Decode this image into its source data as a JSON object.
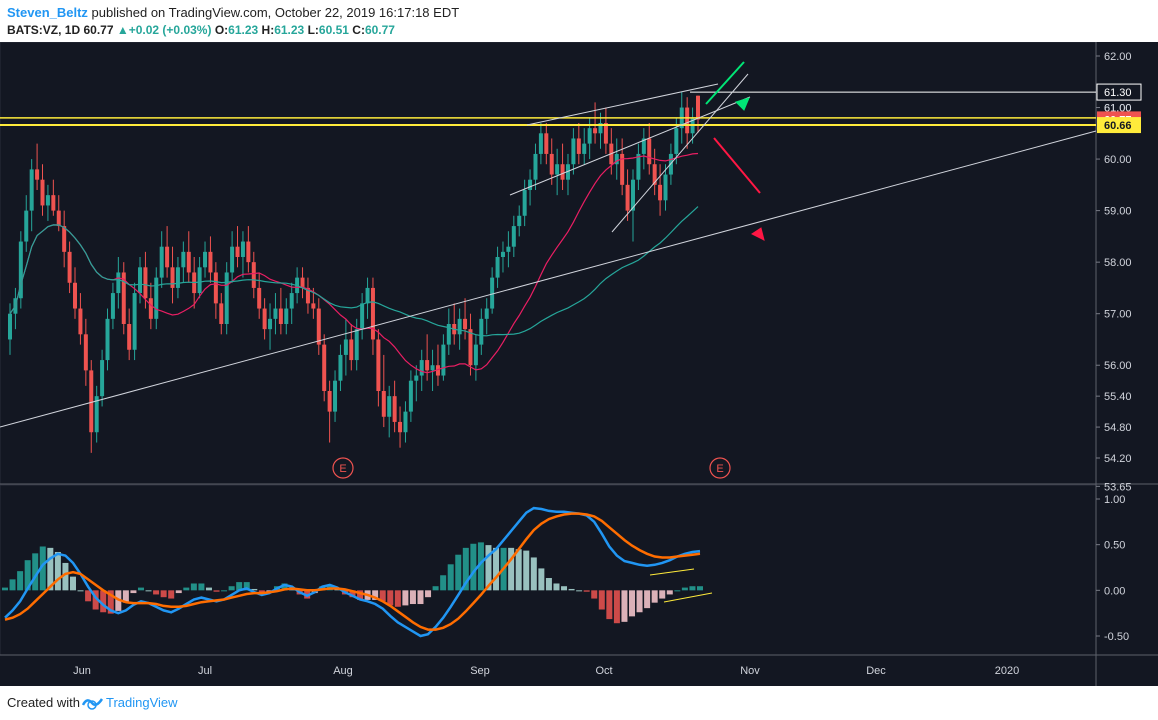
{
  "header": {
    "author": "Steven_Beltz",
    "published_text": "published on TradingView.com, October 22, 2019 16:17:18 EDT",
    "symbol": "BATS:VZ, 1D",
    "last": "60.77",
    "change_arrow": "▲",
    "change": "+0.02 (+0.03%)",
    "o_label": "O:",
    "o": "61.23",
    "h_label": "H:",
    "h": "61.23",
    "l_label": "L:",
    "l": "60.51",
    "c_label": "C:",
    "c": "60.77"
  },
  "footer": {
    "created_with": "Created with",
    "brand": "TradingView"
  },
  "colors": {
    "background": "#131722",
    "up": "#26a69a",
    "down": "#ef5350",
    "ma_fast": "#e91e63",
    "ma_slow": "#26a69a",
    "macd": "#2196f3",
    "signal": "#ff6d00",
    "hline": "#ffeb3b",
    "trend": "#d1d4dc"
  },
  "chart_data": [
    {
      "type": "candlestick",
      "symbol": "BATS:VZ",
      "timeframe": "1D",
      "y_axis_ticks": [
        "62.00",
        "61.00",
        "60.00",
        "59.00",
        "58.00",
        "57.00",
        "56.00",
        "55.40",
        "54.80",
        "54.20",
        "53.65"
      ],
      "y_axis_values": [
        62.0,
        61.0,
        60.0,
        59.0,
        58.0,
        57.0,
        56.0,
        55.4,
        54.8,
        54.2,
        53.65
      ],
      "x_axis_labels": [
        "Jun",
        "Jul",
        "Aug",
        "Sep",
        "Oct",
        "Nov",
        "Dec",
        "2020"
      ],
      "price_labels": [
        {
          "text": "61.30",
          "value": 61.3
        },
        {
          "text": "61.00",
          "value": 61.0
        },
        {
          "text": "60.77",
          "value": 60.77
        },
        {
          "text": "60.66",
          "value": 60.66
        }
      ],
      "horizontal_lines": [
        61.3,
        60.8,
        60.66
      ],
      "earnings_markers": [
        {
          "label": "E",
          "date": "2019-07-30"
        },
        {
          "label": "E",
          "date": "2019-10-22"
        }
      ],
      "candles_ohlc": [
        [
          56.5,
          57.2,
          56.2,
          57.0
        ],
        [
          57.0,
          57.5,
          56.7,
          57.3
        ],
        [
          57.3,
          58.6,
          57.1,
          58.4
        ],
        [
          58.4,
          59.3,
          58.2,
          59.0
        ],
        [
          59.0,
          60.0,
          58.6,
          59.8
        ],
        [
          59.8,
          60.3,
          59.4,
          59.6
        ],
        [
          59.6,
          59.9,
          58.9,
          59.1
        ],
        [
          59.1,
          59.5,
          58.8,
          59.3
        ],
        [
          59.3,
          59.6,
          58.9,
          59.0
        ],
        [
          59.0,
          59.3,
          58.6,
          58.7
        ],
        [
          58.7,
          59.0,
          57.9,
          58.2
        ],
        [
          58.2,
          58.4,
          57.4,
          57.6
        ],
        [
          57.6,
          57.9,
          56.9,
          57.1
        ],
        [
          57.1,
          57.4,
          56.4,
          56.6
        ],
        [
          56.6,
          56.9,
          55.6,
          55.9
        ],
        [
          55.9,
          56.1,
          54.3,
          54.7
        ],
        [
          54.7,
          55.6,
          54.5,
          55.4
        ],
        [
          55.4,
          56.3,
          55.2,
          56.1
        ],
        [
          56.1,
          57.1,
          55.9,
          56.9
        ],
        [
          56.9,
          57.6,
          56.7,
          57.4
        ],
        [
          57.4,
          58.1,
          57.1,
          57.8
        ],
        [
          57.8,
          58.0,
          56.6,
          56.8
        ],
        [
          56.8,
          57.1,
          56.1,
          56.3
        ],
        [
          56.3,
          57.6,
          56.1,
          57.4
        ],
        [
          57.4,
          58.1,
          57.2,
          57.9
        ],
        [
          57.9,
          58.2,
          57.1,
          57.3
        ],
        [
          57.3,
          57.6,
          56.7,
          56.9
        ],
        [
          56.9,
          57.9,
          56.7,
          57.7
        ],
        [
          57.7,
          58.6,
          57.5,
          58.3
        ],
        [
          58.3,
          58.7,
          57.7,
          57.9
        ],
        [
          57.9,
          58.3,
          57.2,
          57.5
        ],
        [
          57.5,
          58.1,
          57.3,
          57.9
        ],
        [
          57.9,
          58.4,
          57.6,
          58.2
        ],
        [
          58.2,
          58.6,
          57.6,
          57.8
        ],
        [
          57.8,
          58.1,
          57.1,
          57.4
        ],
        [
          57.4,
          58.1,
          57.3,
          57.9
        ],
        [
          57.9,
          58.4,
          57.7,
          58.2
        ],
        [
          58.2,
          58.5,
          57.6,
          57.8
        ],
        [
          57.8,
          58.0,
          56.9,
          57.2
        ],
        [
          57.2,
          57.4,
          56.6,
          56.8
        ],
        [
          56.8,
          58.0,
          56.6,
          57.8
        ],
        [
          57.8,
          58.6,
          57.6,
          58.3
        ],
        [
          58.3,
          58.7,
          57.9,
          58.1
        ],
        [
          58.1,
          58.6,
          57.7,
          58.4
        ],
        [
          58.4,
          58.7,
          57.8,
          58.0
        ],
        [
          58.0,
          58.2,
          57.3,
          57.5
        ],
        [
          57.5,
          57.8,
          56.9,
          57.1
        ],
        [
          57.1,
          57.3,
          56.5,
          56.7
        ],
        [
          56.7,
          57.2,
          56.3,
          56.9
        ],
        [
          56.9,
          57.4,
          56.6,
          57.1
        ],
        [
          57.1,
          57.5,
          56.6,
          56.8
        ],
        [
          56.8,
          57.3,
          56.6,
          57.1
        ],
        [
          57.1,
          57.6,
          56.8,
          57.4
        ],
        [
          57.4,
          57.9,
          57.2,
          57.7
        ],
        [
          57.7,
          57.9,
          57.3,
          57.5
        ],
        [
          57.5,
          57.7,
          57.0,
          57.2
        ],
        [
          57.2,
          57.5,
          56.9,
          57.1
        ],
        [
          57.1,
          57.3,
          56.2,
          56.4
        ],
        [
          56.4,
          56.6,
          55.3,
          55.5
        ],
        [
          55.5,
          55.7,
          54.5,
          55.1
        ],
        [
          55.1,
          55.9,
          54.9,
          55.7
        ],
        [
          55.7,
          56.4,
          55.5,
          56.2
        ],
        [
          56.2,
          56.9,
          55.8,
          56.5
        ],
        [
          56.5,
          56.8,
          55.9,
          56.1
        ],
        [
          56.1,
          56.9,
          55.9,
          56.7
        ],
        [
          56.7,
          57.4,
          56.5,
          57.2
        ],
        [
          57.2,
          57.7,
          56.9,
          57.5
        ],
        [
          57.5,
          57.7,
          56.2,
          56.5
        ],
        [
          56.5,
          56.7,
          55.2,
          55.5
        ],
        [
          55.5,
          56.2,
          54.8,
          55.0
        ],
        [
          55.0,
          55.6,
          54.6,
          55.4
        ],
        [
          55.4,
          55.7,
          54.7,
          54.9
        ],
        [
          54.9,
          55.2,
          54.4,
          54.7
        ],
        [
          54.7,
          55.3,
          54.5,
          55.1
        ],
        [
          55.1,
          55.9,
          54.9,
          55.7
        ],
        [
          55.7,
          56.0,
          55.3,
          55.8
        ],
        [
          55.8,
          56.3,
          55.5,
          56.1
        ],
        [
          56.1,
          56.6,
          55.7,
          55.9
        ],
        [
          55.9,
          56.3,
          55.5,
          56.0
        ],
        [
          56.0,
          56.4,
          55.6,
          55.8
        ],
        [
          55.8,
          56.6,
          55.7,
          56.4
        ],
        [
          56.4,
          57.1,
          56.2,
          56.8
        ],
        [
          56.8,
          57.2,
          56.4,
          56.6
        ],
        [
          56.6,
          57.1,
          56.3,
          56.9
        ],
        [
          56.9,
          57.3,
          56.5,
          56.7
        ],
        [
          56.7,
          57.0,
          55.8,
          56.0
        ],
        [
          56.0,
          56.6,
          55.7,
          56.4
        ],
        [
          56.4,
          57.1,
          56.2,
          56.9
        ],
        [
          56.9,
          57.3,
          56.6,
          57.1
        ],
        [
          57.1,
          57.9,
          57.0,
          57.7
        ],
        [
          57.7,
          58.3,
          57.5,
          58.1
        ],
        [
          58.1,
          58.4,
          57.8,
          58.2
        ],
        [
          58.2,
          58.6,
          57.9,
          58.3
        ],
        [
          58.3,
          58.9,
          58.1,
          58.7
        ],
        [
          58.7,
          59.1,
          58.5,
          58.9
        ],
        [
          58.9,
          59.6,
          58.7,
          59.4
        ],
        [
          59.4,
          59.8,
          59.1,
          59.6
        ],
        [
          59.6,
          60.3,
          59.4,
          60.1
        ],
        [
          60.1,
          60.7,
          59.9,
          60.5
        ],
        [
          60.5,
          60.7,
          59.9,
          60.1
        ],
        [
          60.1,
          60.4,
          59.5,
          59.7
        ],
        [
          59.7,
          60.2,
          59.3,
          59.9
        ],
        [
          59.9,
          60.3,
          59.4,
          59.6
        ],
        [
          59.6,
          60.1,
          59.3,
          59.9
        ],
        [
          59.9,
          60.6,
          59.7,
          60.4
        ],
        [
          60.4,
          60.7,
          59.9,
          60.1
        ],
        [
          60.1,
          60.6,
          59.9,
          60.3
        ],
        [
          60.3,
          60.8,
          60.0,
          60.6
        ],
        [
          60.6,
          61.1,
          60.3,
          60.5
        ],
        [
          60.5,
          60.9,
          60.2,
          60.7
        ],
        [
          60.7,
          61.0,
          60.1,
          60.3
        ],
        [
          60.3,
          60.6,
          59.7,
          59.9
        ],
        [
          59.9,
          60.4,
          59.6,
          60.1
        ],
        [
          60.1,
          60.4,
          59.3,
          59.5
        ],
        [
          59.5,
          59.8,
          58.8,
          59.0
        ],
        [
          59.0,
          59.8,
          58.4,
          59.6
        ],
        [
          59.6,
          60.3,
          59.4,
          60.1
        ],
        [
          60.1,
          60.6,
          59.8,
          60.4
        ],
        [
          60.4,
          60.7,
          59.7,
          59.9
        ],
        [
          59.9,
          60.2,
          59.3,
          59.5
        ],
        [
          59.5,
          59.9,
          58.9,
          59.2
        ],
        [
          59.2,
          59.9,
          59.0,
          59.7
        ],
        [
          59.7,
          60.3,
          59.5,
          60.1
        ],
        [
          60.1,
          60.8,
          59.9,
          60.6
        ],
        [
          60.6,
          61.3,
          60.3,
          61.0
        ],
        [
          61.0,
          61.2,
          60.2,
          60.5
        ],
        [
          60.5,
          61.0,
          60.3,
          60.8
        ],
        [
          61.23,
          61.23,
          60.51,
          60.77
        ]
      ],
      "moving_averages": {
        "fast_visible": true,
        "slow_visible": true
      }
    },
    {
      "type": "line",
      "name": "MACD",
      "y_axis_ticks": [
        "1.00",
        "0.50",
        "0.00",
        "-0.50"
      ],
      "y_axis_values": [
        1.0,
        0.5,
        0.0,
        -0.5
      ],
      "series": [
        {
          "values": [
            -0.3,
            -0.22,
            -0.12,
            0.02,
            0.15,
            0.28,
            0.35,
            0.4,
            0.38,
            0.3,
            0.18,
            0.04,
            -0.08,
            -0.16,
            -0.22,
            -0.25,
            -0.22,
            -0.16,
            -0.12,
            -0.14,
            -0.18,
            -0.22,
            -0.24,
            -0.2,
            -0.15,
            -0.1,
            -0.08,
            -0.1,
            -0.12,
            -0.1,
            -0.05,
            0.0,
            0.02,
            -0.02,
            -0.05,
            -0.03,
            0.02,
            0.06,
            0.04,
            -0.02,
            -0.06,
            -0.02,
            0.04,
            0.06,
            0.03,
            -0.02,
            -0.06,
            -0.1,
            -0.12,
            -0.15,
            -0.2,
            -0.28,
            -0.35,
            -0.4,
            -0.45,
            -0.5,
            -0.48,
            -0.4,
            -0.3,
            -0.18,
            -0.05,
            0.08,
            0.2,
            0.3,
            0.38,
            0.45,
            0.55,
            0.65,
            0.75,
            0.85,
            0.9,
            0.89,
            0.87,
            0.86,
            0.86,
            0.85,
            0.84,
            0.82,
            0.75,
            0.62,
            0.48,
            0.38,
            0.32,
            0.3,
            0.28,
            0.27,
            0.28,
            0.3,
            0.33,
            0.37,
            0.4,
            0.42,
            0.43
          ]
        },
        {
          "values": [
            -0.32,
            -0.3,
            -0.26,
            -0.2,
            -0.12,
            -0.04,
            0.04,
            0.12,
            0.18,
            0.2,
            0.18,
            0.12,
            0.06,
            0.0,
            -0.05,
            -0.1,
            -0.13,
            -0.14,
            -0.14,
            -0.14,
            -0.15,
            -0.17,
            -0.18,
            -0.18,
            -0.17,
            -0.15,
            -0.13,
            -0.12,
            -0.11,
            -0.1,
            -0.08,
            -0.06,
            -0.04,
            -0.03,
            -0.03,
            -0.02,
            -0.01,
            0.01,
            0.02,
            0.01,
            0.0,
            0.0,
            0.01,
            0.02,
            0.02,
            0.01,
            -0.01,
            -0.03,
            -0.05,
            -0.08,
            -0.12,
            -0.17,
            -0.23,
            -0.29,
            -0.35,
            -0.4,
            -0.43,
            -0.43,
            -0.41,
            -0.37,
            -0.31,
            -0.23,
            -0.14,
            -0.05,
            0.05,
            0.14,
            0.24,
            0.34,
            0.45,
            0.56,
            0.66,
            0.73,
            0.78,
            0.81,
            0.83,
            0.84,
            0.84,
            0.83,
            0.81,
            0.76,
            0.69,
            0.62,
            0.55,
            0.49,
            0.44,
            0.4,
            0.37,
            0.36,
            0.36,
            0.37,
            0.38,
            0.39,
            0.4
          ]
        }
      ],
      "histogram_visible": true
    }
  ]
}
